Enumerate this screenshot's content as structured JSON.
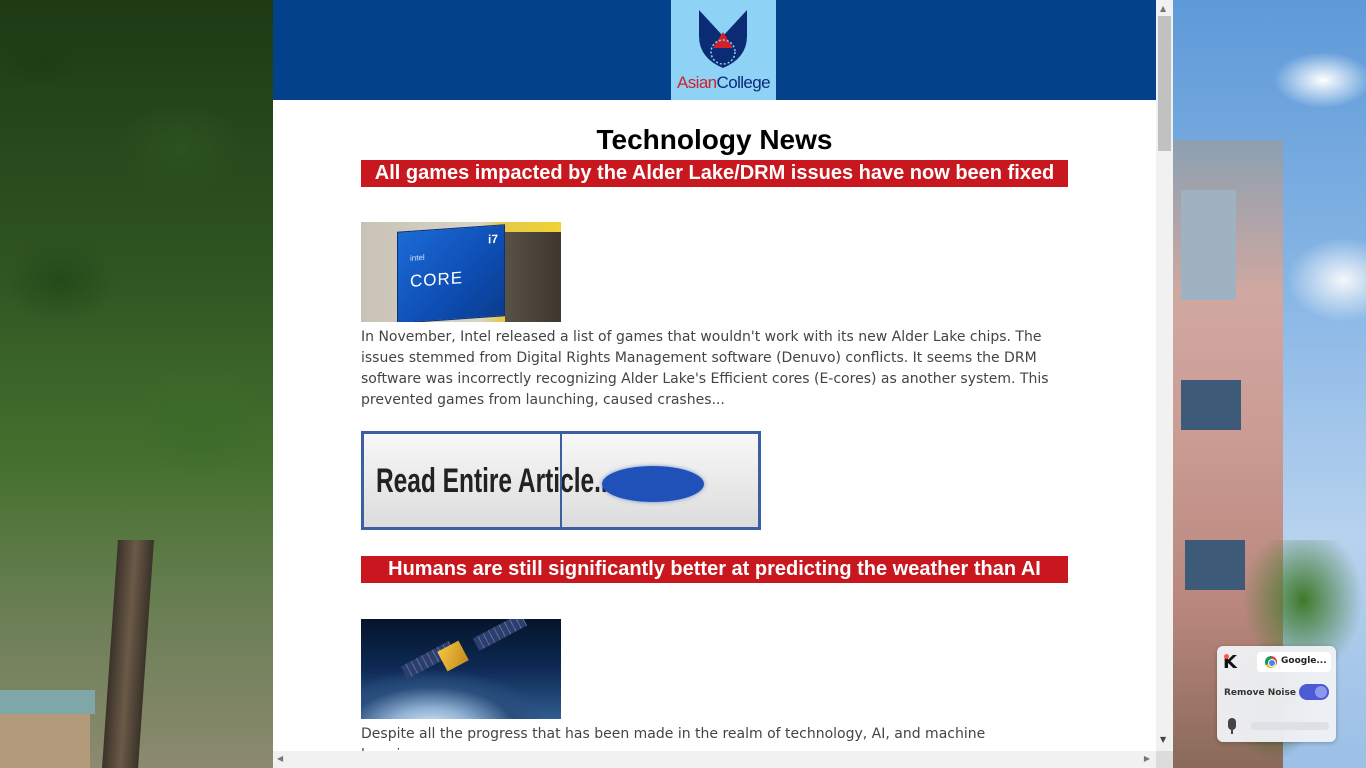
{
  "logo": {
    "text_part1": "Asian",
    "text_part2": "College"
  },
  "page": {
    "title": "Technology News"
  },
  "articles": [
    {
      "headline": "All games impacted by the Alder Lake/DRM issues have now been fixed",
      "image_caption_i7": "i7",
      "image_caption_intel": "intel",
      "image_caption_core": "CORE",
      "excerpt": "In November, Intel released a list of games that wouldn't work with its new Alder Lake chips. The issues stemmed from Digital Rights Management software (Denuvo) conflicts. It seems the DRM software was incorrectly recognizing Alder Lake's Efficient cores (E-cores) as another system. This prevented games from launching, caused crashes..."
    },
    {
      "headline": "Humans are still significantly better at predicting the weather than AI",
      "excerpt": "Despite all the progress that has been made in the realm of technology, AI, and machine learning,"
    }
  ],
  "read_button": {
    "label": "Read Entire Article..."
  },
  "widget": {
    "app_name": "Google...",
    "remove_noise_label": "Remove Noise",
    "remove_noise_on": true
  }
}
